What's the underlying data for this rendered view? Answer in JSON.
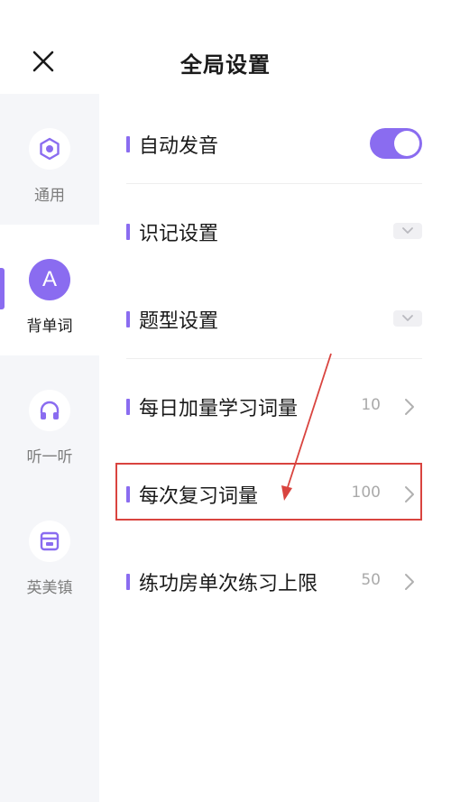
{
  "header": {
    "title": "全局设置",
    "close_icon": "close-icon"
  },
  "sidebar": {
    "items": [
      {
        "label": "通用",
        "icon": "hexagon-gear-icon",
        "active": false
      },
      {
        "label": "背单词",
        "icon": "letter-a-icon",
        "icon_text": "A",
        "active": true
      },
      {
        "label": "听一听",
        "icon": "headphones-icon",
        "active": false
      },
      {
        "label": "英美镇",
        "icon": "town-icon",
        "active": false
      }
    ]
  },
  "settings": {
    "rows": [
      {
        "label": "自动发音",
        "control": "toggle",
        "toggle_on": true
      },
      {
        "label": "识记设置",
        "control": "dropdown"
      },
      {
        "label": "题型设置",
        "control": "dropdown"
      },
      {
        "label": "每日加量学习词量",
        "value": "10",
        "control": "chevron"
      },
      {
        "label": "每次复习词量",
        "value": "100",
        "control": "chevron",
        "highlighted": true
      },
      {
        "label": "练功房单次练习上限",
        "value": "50",
        "control": "chevron"
      }
    ]
  },
  "colors": {
    "accent": "#8a6cf0",
    "annotation": "#d9443f",
    "sidebar_bg": "#f5f6f9"
  }
}
